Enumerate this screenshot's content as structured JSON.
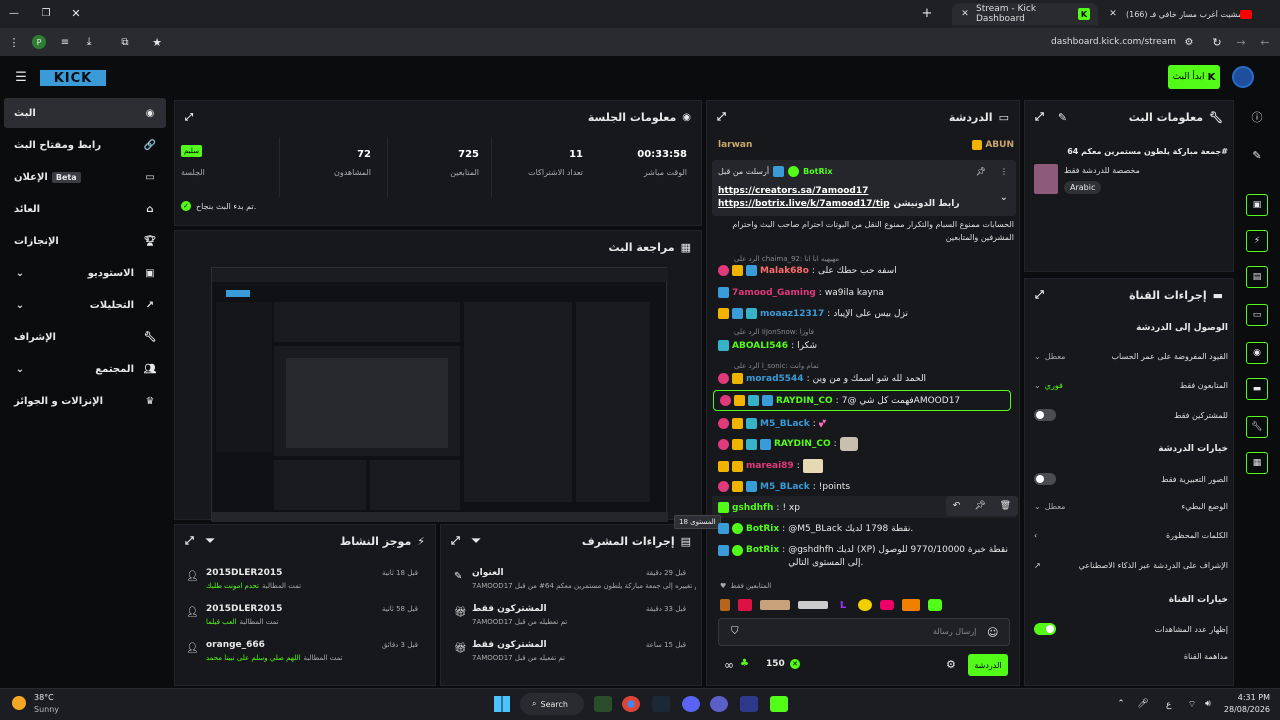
{
  "browser": {
    "tabs": [
      {
        "label": "Stream - Kick Dashboard"
      },
      {
        "label": "(166) مشيت أغرب مسار خافي فـ"
      }
    ],
    "url": "dashboard.kick.com/stream"
  },
  "header": {
    "logo": "KICK",
    "go_live": "ابدأ البث"
  },
  "nav": {
    "items": [
      {
        "label": "البث"
      },
      {
        "label": "رابط ومفتاح البث"
      },
      {
        "label": "الإعلان",
        "badge": "Beta"
      },
      {
        "label": "العائد"
      },
      {
        "label": "الإنجازات"
      },
      {
        "label": "الاستوديو"
      },
      {
        "label": "التحليلات"
      },
      {
        "label": "الإشراف"
      },
      {
        "label": "المجتمع"
      },
      {
        "label": "الإنزالات و الجوائز"
      }
    ]
  },
  "session": {
    "title": "معلومات الجلسة",
    "stats": [
      {
        "value": "00:33:58",
        "label": "الوقت مباشر"
      },
      {
        "value": "11",
        "label": "تعداد الاشتراكات"
      },
      {
        "value": "725",
        "label": "المتابعين"
      },
      {
        "value": "72",
        "label": "المشاهدون"
      }
    ],
    "session_badge": "سليم",
    "session_label": "الجلسة",
    "status": "تم بدء البث بنجاح."
  },
  "preview": {
    "title": "مراجعة البث"
  },
  "activity": {
    "title": "موجز النشاط",
    "items": [
      {
        "user": "2015DLER2015",
        "time": "قبل 18 ثانية",
        "desc": "تمت المطالبة",
        "reward": "تحدم امونت طلبك"
      },
      {
        "user": "2015DLER2015",
        "time": "قبل 58 ثانية",
        "desc": "تمت المطالبة",
        "reward": "العب قيلما"
      },
      {
        "user": "orange_666",
        "time": "قبل 3 دقائق",
        "desc": "تمت المطالبة",
        "reward": "اللهم صلي وسلم على نبينا محمد"
      }
    ]
  },
  "modactions": {
    "title": "إجراءات المشرف",
    "items": [
      {
        "title": "العنوان",
        "time": "قبل 29 دقيقة",
        "desc": "7AMOOD17 تم تغييره إلى جمعة مباركة يلطون مستمرين معكم 64# من قبل"
      },
      {
        "title": "المشتركون فقط",
        "time": "قبل 33 دقيقة",
        "desc": "7AMOOD17 تم تعطيله من قبل"
      },
      {
        "title": "المشتركون فقط",
        "time": "قبل 15 ساعة",
        "desc": "7AMOOD17 تم تفعيله من قبل"
      }
    ]
  },
  "chat": {
    "title": "الدردشة",
    "top_user": "larwan",
    "top_user2": "ABUN",
    "pinned": {
      "by": "أرسلت من قبل",
      "user": "BotRix",
      "link1": "https://creators.sa/7amood17",
      "link2": "https://botrix.live/k/7amood17/tip",
      "tail": "رابط الدونيشن"
    },
    "rules": "الحسابات ممنوع السبام والتكرار ممنوع النقل من البوتات احترام صاحب البث واحترام المشرفين والمتابعين",
    "messages": [
      {
        "reply": "الرد على chaima_92: مهيهيه انا انا",
        "user": "Malak68o",
        "color": "#ff6b6b",
        "text": "اسفه حب حطك على"
      },
      {
        "user": "7amood_Gaming",
        "color": "#e0397c",
        "text": "wa9ila kayna"
      },
      {
        "user": "moaaz12317",
        "color": "#3a9bd9",
        "text": "نزل بيس على الإيباد"
      },
      {
        "reply": "الرد على IiJonSnow: فاوزا",
        "user": "ABOALI546",
        "color": "#53fc18",
        "text": "شكرا"
      },
      {
        "reply": "الرد على l_sonic: تمام وانت",
        "user": "morad5544",
        "color": "#3a9bd9",
        "text": "الحمد لله شو اسمك و من وين"
      },
      {
        "user": "RAYDIN_CO",
        "color": "#53fc18",
        "text": "فهمت كل شي @7AMOOD17"
      },
      {
        "user": "M5_BLack",
        "color": "#3a9bd9",
        "text": ""
      },
      {
        "user": "RAYDIN_CO",
        "color": "#53fc18",
        "text": ""
      },
      {
        "user": "mareai89",
        "color": "#e0397c",
        "text": ""
      },
      {
        "user": "M5_BLack",
        "color": "#3a9bd9",
        "text": "!points"
      },
      {
        "user": "gshdhfh",
        "color": "#53fc18",
        "text": "! xp"
      },
      {
        "user": "BotRix",
        "color": "#53fc18",
        "text": "@M5_BLack نقطة 1798 لديك."
      },
      {
        "user": "BotRix",
        "color": "#53fc18",
        "text": "@gshdhfh لديك (XP) نقطة خبرة 9770/10000 للوصول إلى المستوى التالي."
      }
    ],
    "tooltip": "المستوى 18",
    "followers_only": "المتابعين فقط",
    "input_placeholder": "إرسال رسالة",
    "points": "150",
    "send": "الدردشة"
  },
  "streaminfo": {
    "title": "معلومات البث",
    "stream_title": "جمعة مباركة يلطون مستمرين معكم 64#",
    "subtitle": "مخصصة للدردشة فقط",
    "language": "Arabic"
  },
  "channel": {
    "title": "إجراءات القناة",
    "access_heading": "الوصول إلى الدردشة",
    "rows": [
      {
        "label": "القيود المفروضة على عمر الحساب",
        "value": "معطل"
      },
      {
        "label": "المتابعون فقط",
        "value": "فوري"
      },
      {
        "label": "للمشتركين فقط",
        "toggle": "off"
      }
    ],
    "chat_options_heading": "خيارات الدردشة",
    "chat_rows": [
      {
        "label": "الصور التعبيرية فقط",
        "toggle": "off"
      },
      {
        "label": "الوضع البطيء",
        "value": "معطل"
      },
      {
        "label": "الكلمات المحظورة"
      },
      {
        "label": "الإشراف على الدردشة عبر الذكاء الاصطناعي"
      }
    ],
    "channel_options_heading": "خيارات القناة",
    "channel_rows": [
      {
        "label": "إظهار عدد المشاهدات",
        "toggle": "on"
      },
      {
        "label": "مداهمة القناة"
      }
    ]
  },
  "taskbar": {
    "weather_temp": "38°C",
    "weather_desc": "Sunny",
    "search": "Search",
    "time": "4:31 PM",
    "date": "28/08/2026",
    "lang": "ع"
  }
}
